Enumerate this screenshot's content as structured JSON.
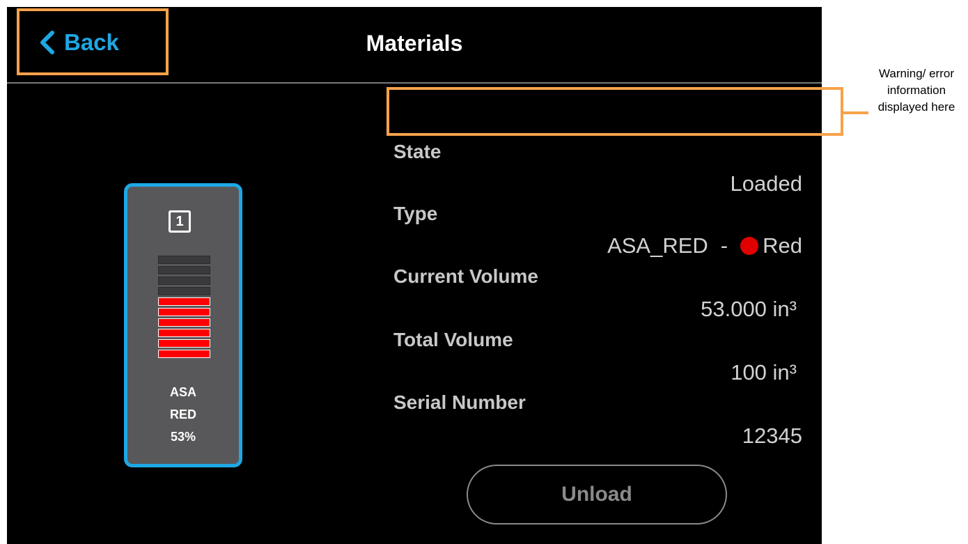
{
  "header": {
    "back_label": "Back",
    "title": "Materials"
  },
  "annotation": {
    "text": "Warning/ error information displayed here",
    "color": "#f7a24a"
  },
  "canister": {
    "slot": "1",
    "name_line1": "ASA",
    "name_line2": "RED",
    "percent_text": "53%",
    "fill_level": 0.53,
    "accent_color": "#1ea7e4",
    "material_color": "#ff0000"
  },
  "details": {
    "state_label": "State",
    "state_value": "Loaded",
    "type_label": "Type",
    "type_code": "ASA_RED",
    "type_separator": "-",
    "color_name": "Red",
    "current_volume_label": "Current Volume",
    "current_volume_value": "53.000 in³",
    "total_volume_label": "Total Volume",
    "total_volume_value": "100 in³",
    "serial_label": "Serial Number",
    "serial_value": "12345"
  },
  "actions": {
    "unload_label": "Unload"
  },
  "icons": {
    "back": "chevron-left-icon",
    "color_swatch": "color-dot-icon"
  }
}
